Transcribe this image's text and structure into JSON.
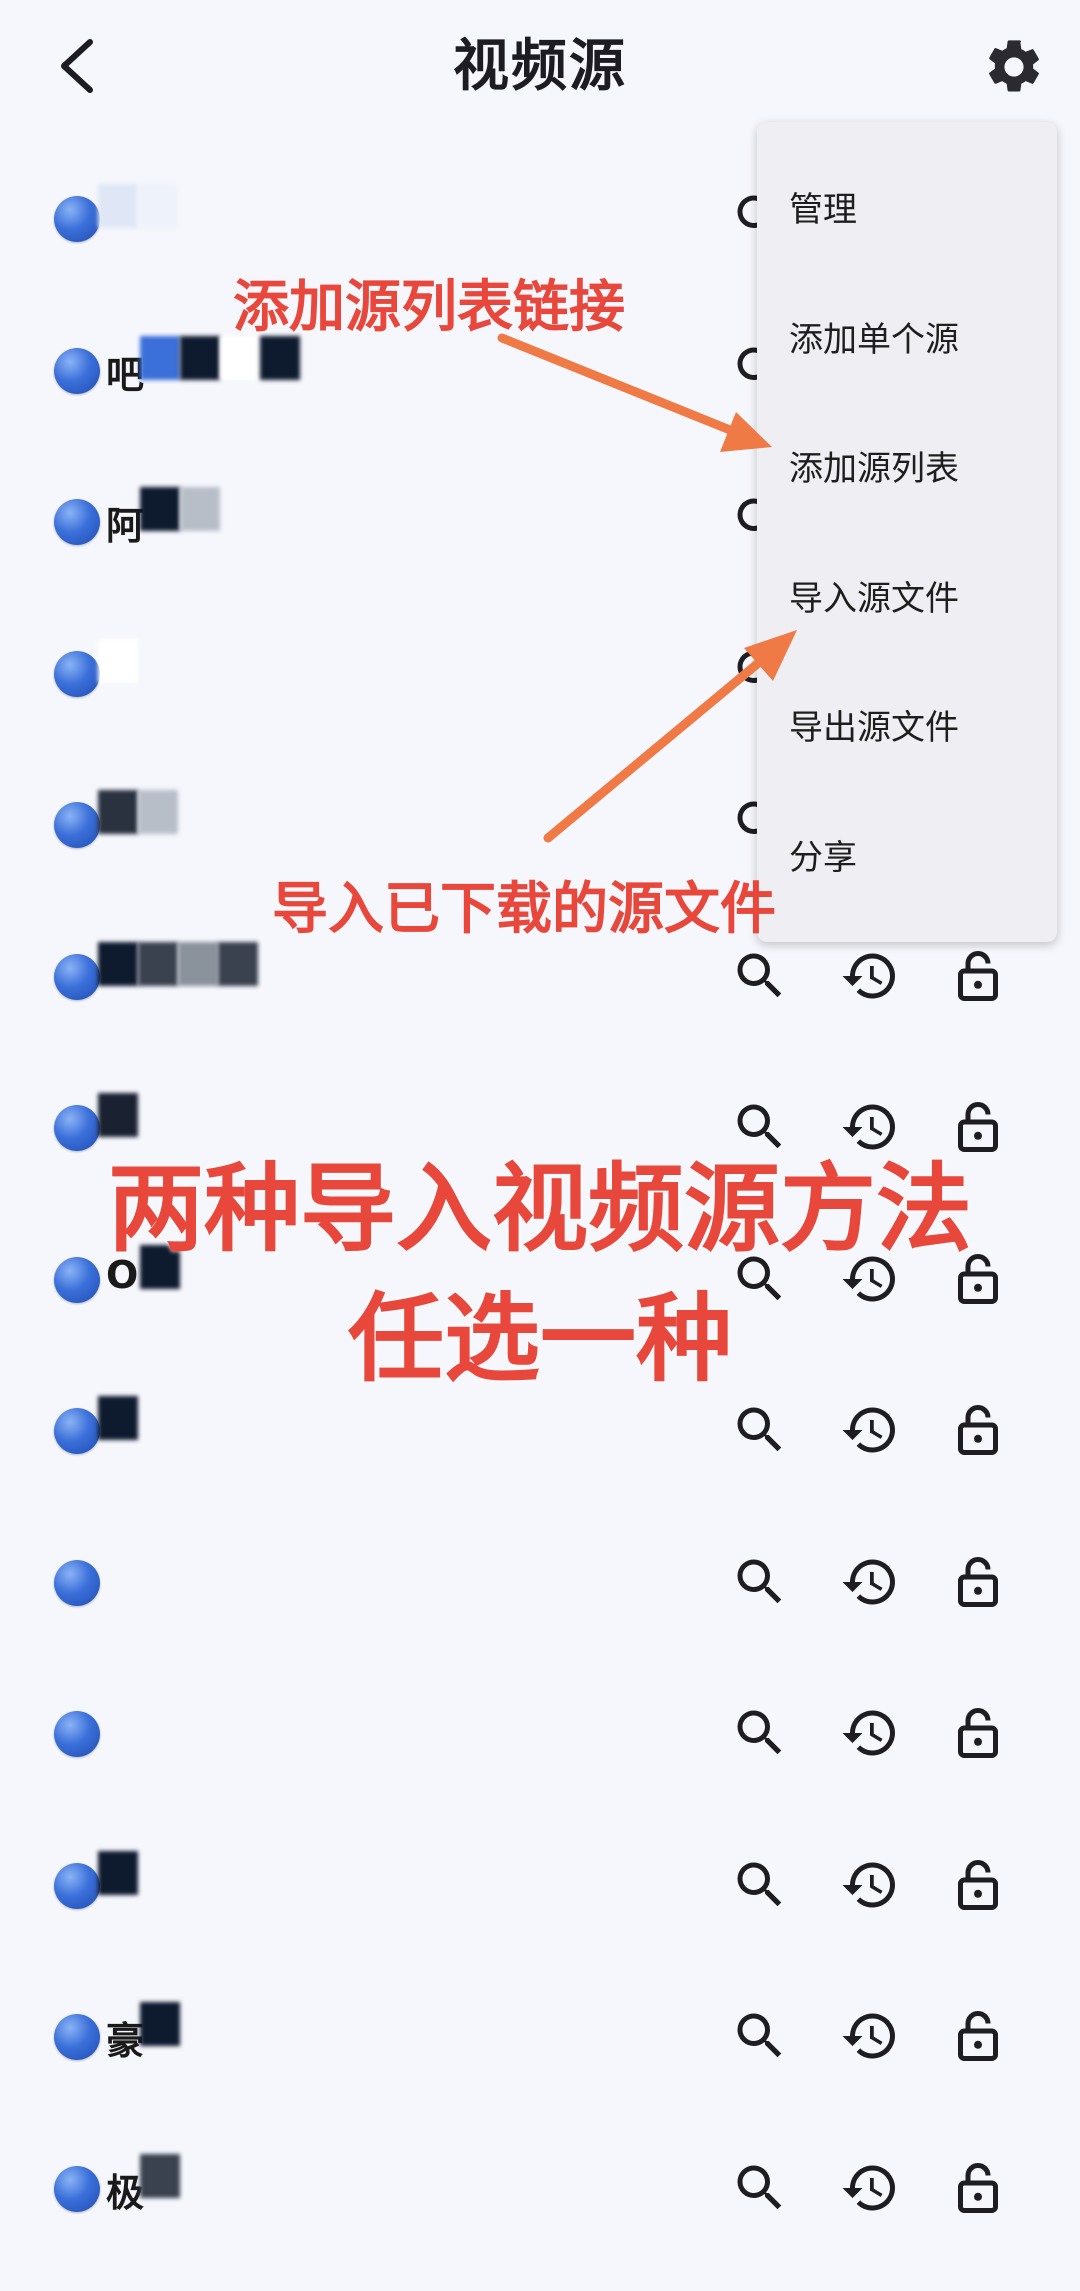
{
  "header": {
    "title": "视频源",
    "back_icon": "chevron-left-icon",
    "settings_icon": "gear-icon"
  },
  "sources": [
    {
      "name": "",
      "blur": [
        "#dfe7f6",
        "#eef2fa"
      ]
    },
    {
      "name": "吧",
      "blur": [
        "#3b6fd9",
        "#0e1a2e",
        "#ffffff",
        "#0e1a2e"
      ]
    },
    {
      "name": "阿",
      "blur": [
        "#0e1a2e",
        "#b8bec8"
      ]
    },
    {
      "name": "",
      "blur": [
        "#ffffff"
      ]
    },
    {
      "name": "",
      "blur": [
        "#2a3240",
        "#b8bec8"
      ]
    },
    {
      "name": "",
      "blur": [
        "#0e1a2e",
        "#3a4250",
        "#8a929c",
        "#3a4250"
      ]
    },
    {
      "name": "",
      "blur": [
        "#1a2232"
      ]
    },
    {
      "name": "O",
      "blur": [
        "#0e1a2e"
      ]
    },
    {
      "name": "",
      "blur": [
        "#0e1a2e"
      ]
    },
    {
      "name": "",
      "blur": []
    },
    {
      "name": "",
      "blur": []
    },
    {
      "name": "",
      "blur": [
        "#0e1a2e"
      ]
    },
    {
      "name": "豪",
      "blur": [
        "#0e1a2e"
      ]
    },
    {
      "name": "极",
      "blur": [
        "#3a4250"
      ]
    }
  ],
  "row_actions": [
    "search-icon",
    "history-icon",
    "lock-open-icon"
  ],
  "menu": {
    "items": [
      "管理",
      "添加单个源",
      "添加源列表",
      "导入源文件",
      "导出源文件",
      "分享"
    ]
  },
  "annotations": {
    "add_list_link": "添加源列表链接",
    "import_downloaded": "导入已下载的源文件",
    "headline_1": "两种导入视频源方法",
    "headline_2": "任选一种"
  },
  "colors": {
    "accent_red": "#e8473b",
    "arrow_orange": "#ef7a45",
    "dot_blue": "#3b6fd9"
  }
}
